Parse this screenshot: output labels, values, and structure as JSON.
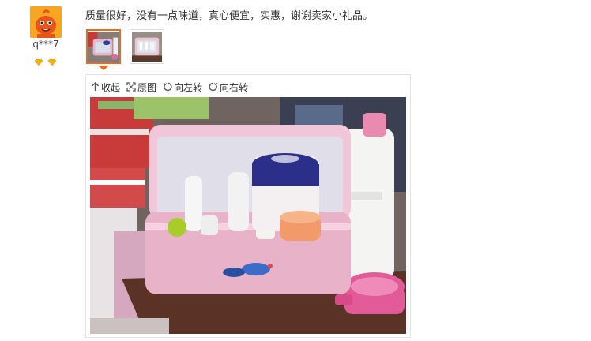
{
  "reviewer": {
    "name": "q***7",
    "avatar_icon": "cartoon-avatar-icon",
    "badge_icon": "diamond-icon",
    "badge_color": "#f5b400"
  },
  "review": {
    "text": "质量很好，没有一点味道，真心便宜，实惠，谢谢卖家小礼品。"
  },
  "thumbnails": [
    {
      "name": "thumbnail-1",
      "selected": true
    },
    {
      "name": "thumbnail-2",
      "selected": false
    }
  ],
  "viewer": {
    "tools": [
      {
        "icon": "collapse-arrow-icon",
        "label": "收起"
      },
      {
        "icon": "fullsize-icon",
        "label": "原图"
      },
      {
        "icon": "rotate-left-icon",
        "label": "向左转"
      },
      {
        "icon": "rotate-right-icon",
        "label": "向右转"
      }
    ]
  },
  "colors": {
    "accent": "#f06a1e",
    "viewer_border": "#e2e2e2"
  }
}
